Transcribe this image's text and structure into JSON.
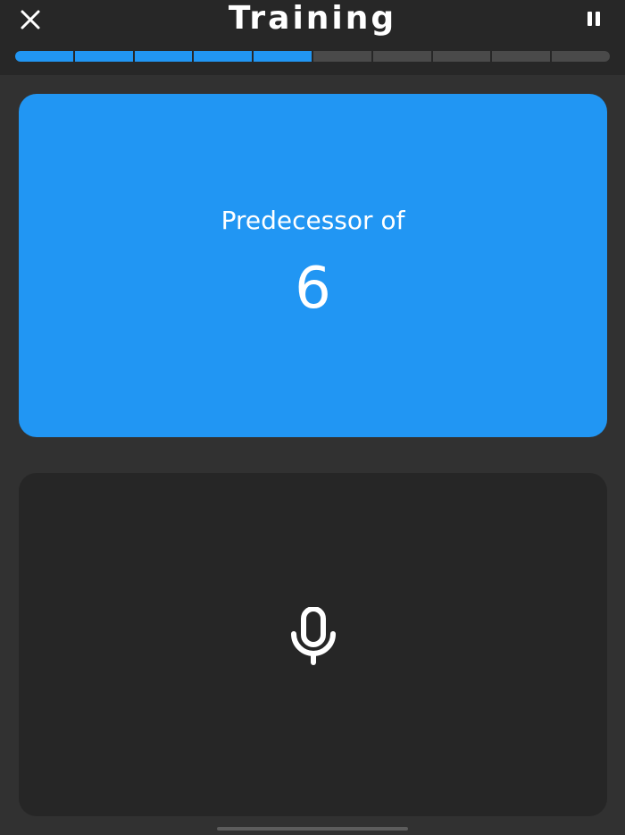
{
  "header": {
    "title": "Training",
    "close_icon": "close-icon",
    "pause_icon": "pause-icon"
  },
  "progress": {
    "completed": 5,
    "total": 10,
    "active_color": "#2196f3",
    "inactive_color": "#4a4a4a"
  },
  "question": {
    "label": "Predecessor of",
    "value": "6",
    "card_color": "#2196f3"
  },
  "answer": {
    "icon": "microphone-icon",
    "card_color": "#262626"
  }
}
